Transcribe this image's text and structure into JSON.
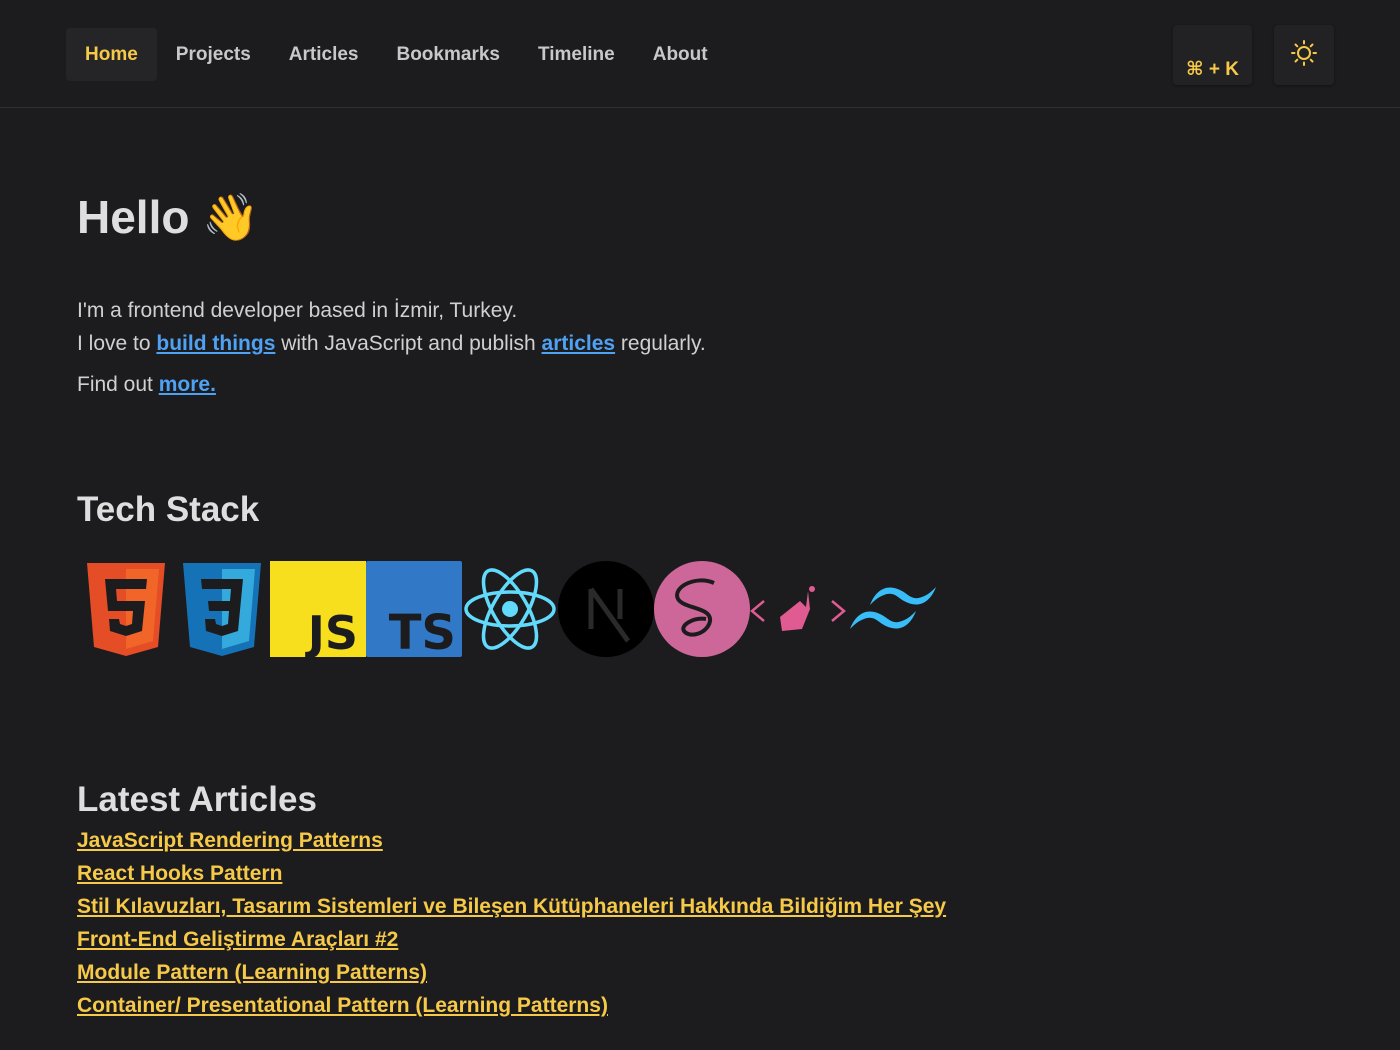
{
  "nav": {
    "items": [
      {
        "label": "Home",
        "active": true
      },
      {
        "label": "Projects"
      },
      {
        "label": "Articles"
      },
      {
        "label": "Bookmarks"
      },
      {
        "label": "Timeline"
      },
      {
        "label": "About"
      }
    ],
    "command_shortcut": "⌘ + K",
    "theme_icon": "sun-icon"
  },
  "hero": {
    "greeting": "Hello 👋",
    "line1": "I'm a frontend developer based in İzmir, Turkey.",
    "line2_pre": "I love to ",
    "line2_link1": "build things",
    "line2_mid": " with JavaScript and publish ",
    "line2_link2": "articles",
    "line2_post": " regularly.",
    "findout_pre": "Find out ",
    "findout_link": "more."
  },
  "tech_stack": {
    "title": "Tech Stack",
    "items": [
      "HTML5",
      "CSS3",
      "JS",
      "TS",
      "React",
      "Next.js",
      "Sass",
      "Storybook",
      "Tailwind CSS"
    ]
  },
  "latest_articles": {
    "title": "Latest Articles",
    "items": [
      "JavaScript Rendering Patterns",
      "React Hooks Pattern",
      "Stil Kılavuzları, Tasarım Sistemleri ve Bileşen Kütüphaneleri Hakkında Bildiğim Her Şey",
      "Front-End Geliştirme Araçları #2",
      "Module Pattern (Learning Patterns)",
      "Container/ Presentational Pattern (Learning Patterns)"
    ]
  },
  "colors": {
    "background": "#1c1c1e",
    "accent": "#f7c948",
    "link": "#4ea1f3"
  }
}
